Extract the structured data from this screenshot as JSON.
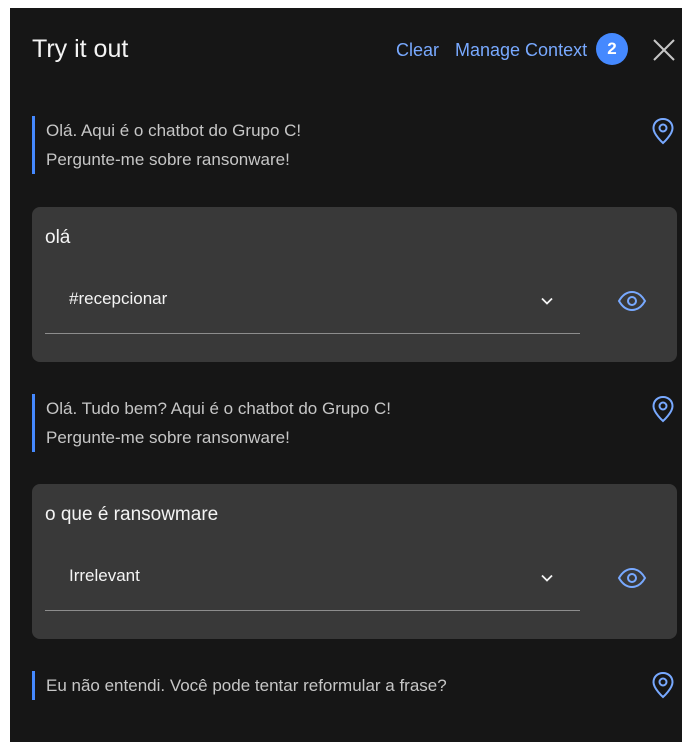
{
  "header": {
    "title": "Try it out",
    "clear_label": "Clear",
    "manage_context_label": "Manage Context",
    "context_count": "2"
  },
  "messages": [
    {
      "lines": [
        "Olá. Aqui é o chatbot do Grupo C!",
        "Pergunte-me sobre ransonware!"
      ]
    },
    {
      "user_text": "olá",
      "intent": "#recepcionar"
    },
    {
      "lines": [
        "Olá. Tudo bem? Aqui é o chatbot do Grupo C!",
        "Pergunte-me sobre ransonware!"
      ]
    },
    {
      "user_text": "o que é ransowmare",
      "intent": "Irrelevant"
    },
    {
      "lines": [
        "Eu não entendi. Você pode tentar reformular a frase?"
      ]
    }
  ],
  "colors": {
    "panel_bg": "#161616",
    "card_bg": "#393939",
    "accent": "#4589ff",
    "link": "#78a9ff"
  },
  "icons": [
    "close-icon",
    "location-pin-icon",
    "chevron-down-icon",
    "eye-icon"
  ]
}
